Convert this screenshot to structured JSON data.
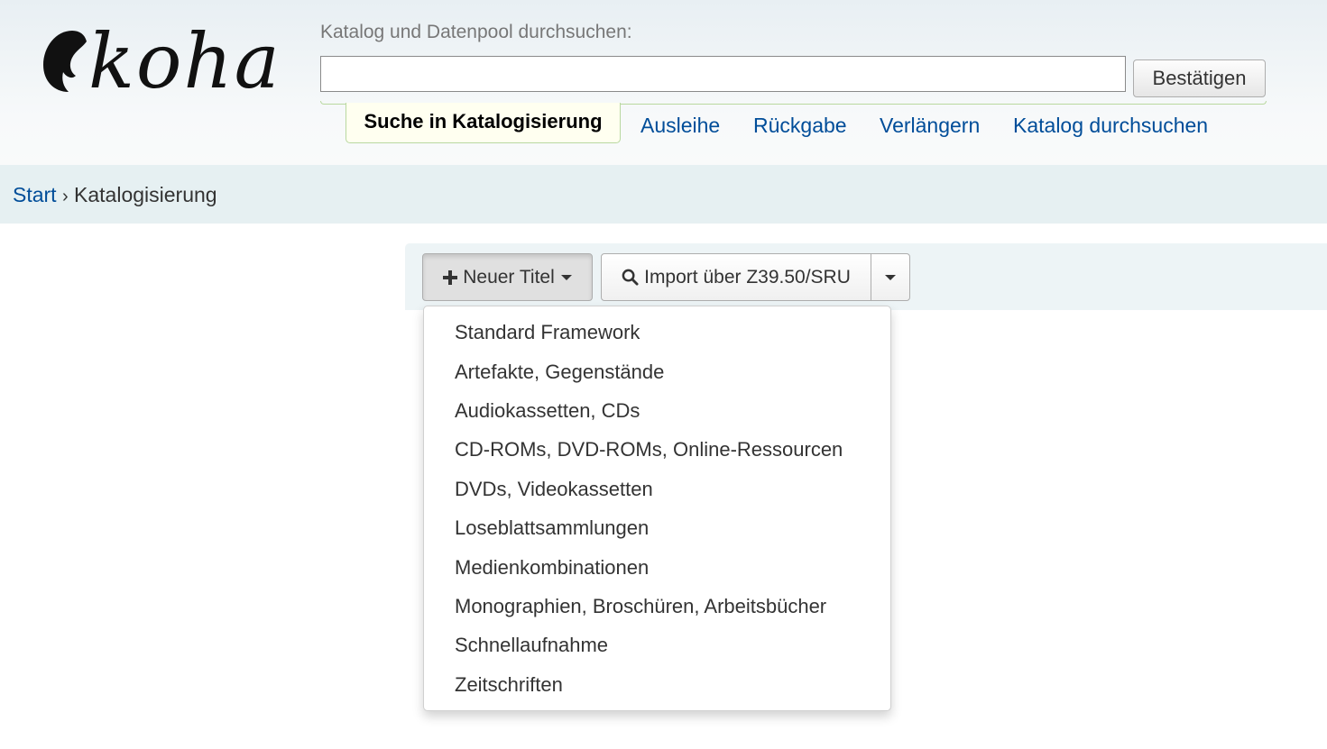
{
  "header": {
    "logo_text": "koha",
    "search_label": "Katalog und Datenpool durchsuchen:",
    "search_value": "",
    "submit_label": "Bestätigen",
    "tabs": [
      {
        "label": "Suche in Katalogisierung",
        "active": true
      },
      {
        "label": "Ausleihe",
        "active": false
      },
      {
        "label": "Rückgabe",
        "active": false
      },
      {
        "label": "Verlängern",
        "active": false
      },
      {
        "label": "Katalog durchsuchen",
        "active": false
      }
    ]
  },
  "breadcrumb": {
    "home": "Start",
    "separator": "›",
    "current": "Katalogisierung"
  },
  "toolbar": {
    "new_record_label": "Neuer Titel",
    "z3950_label": "Import über Z39.50/SRU"
  },
  "framework_menu": {
    "items": [
      "Standard Framework",
      "Artefakte, Gegenstände",
      "Audiokassetten, CDs",
      "CD-ROMs, DVD-ROMs, Online-Ressourcen",
      "DVDs, Videokassetten",
      "Loseblattsammlungen",
      "Medienkombinationen",
      "Monographien, Broschüren, Arbeitsbücher",
      "Schnellaufnahme",
      "Zeitschriften"
    ]
  },
  "colors": {
    "link": "#004d99",
    "tab_border": "#b9d8a0",
    "breadcrumb_bg": "#e6f0f2"
  },
  "icons": [
    "plus-icon",
    "caret-down-icon",
    "search-icon"
  ]
}
